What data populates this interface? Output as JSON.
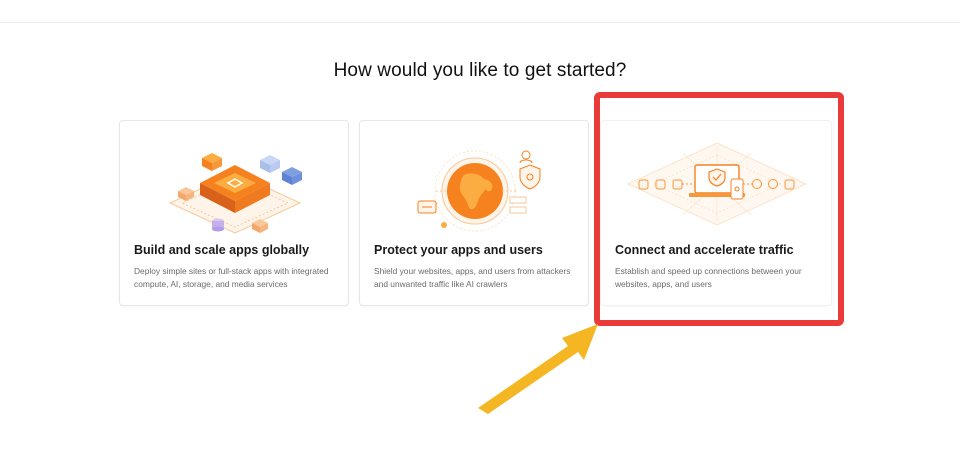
{
  "page": {
    "heading": "How would you like to get started?"
  },
  "cards": [
    {
      "title": "Build and scale apps globally",
      "description": "Deploy simple sites or full-stack apps with integrated compute, AI, storage, and media services",
      "illustration": "isometric-platform-icon"
    },
    {
      "title": "Protect your apps and users",
      "description": "Shield your websites, apps, and users from attackers and unwanted traffic like AI crawlers",
      "illustration": "globe-shield-icon"
    },
    {
      "title": "Connect and accelerate traffic",
      "description": "Establish and speed up connections between your websites, apps, and users",
      "illustration": "network-laptop-shield-icon"
    }
  ],
  "annotations": {
    "highlight_target": "Connect and accelerate traffic",
    "highlight_color": "#ea3a3a",
    "arrow_color": "#f5b623"
  },
  "colors": {
    "accent": "#f48120",
    "accent_light": "#fbad41",
    "text_primary": "#1a1a1a",
    "text_secondary": "#6b6b6b"
  }
}
